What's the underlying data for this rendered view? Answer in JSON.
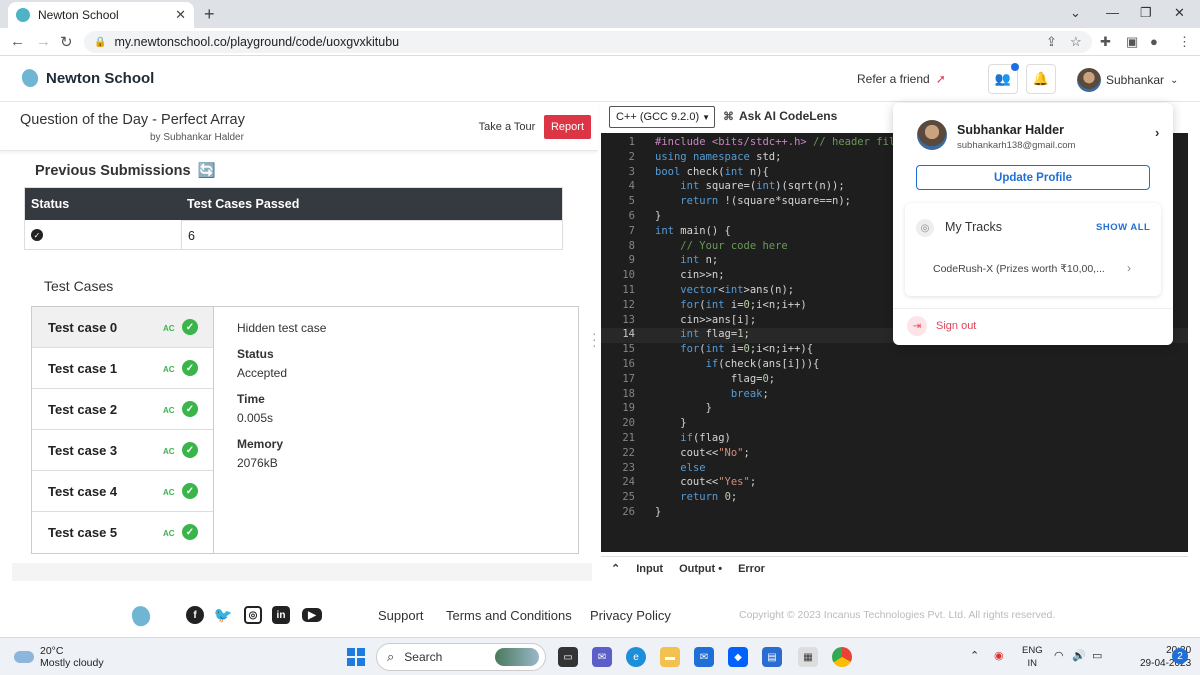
{
  "browser": {
    "tab_title": "Newton School",
    "url": "my.newtonschool.co/playground/code/uoxgvxkitubu"
  },
  "header": {
    "brand": "Newton School",
    "refer": "Refer a friend",
    "username": "Subhankar"
  },
  "question": {
    "title": "Question of the Day - Perfect Array",
    "author": "by Subhankar Halder",
    "tour_label": "Take a Tour",
    "report_label": "Report"
  },
  "previous_submissions": {
    "title": "Previous Submissions",
    "headers": [
      "Status",
      "Test Cases Passed"
    ],
    "rows": [
      {
        "status": "accepted",
        "passed": "6"
      }
    ]
  },
  "test_cases": {
    "title": "Test Cases",
    "items": [
      {
        "label": "Test case 0",
        "badge": "AC"
      },
      {
        "label": "Test case 1",
        "badge": "AC"
      },
      {
        "label": "Test case 2",
        "badge": "AC"
      },
      {
        "label": "Test case 3",
        "badge": "AC"
      },
      {
        "label": "Test case 4",
        "badge": "AC"
      },
      {
        "label": "Test case 5",
        "badge": "AC"
      }
    ],
    "detail": {
      "hidden": "Hidden test case",
      "status_label": "Status",
      "status_value": "Accepted",
      "time_label": "Time",
      "time_value": "0.005s",
      "memory_label": "Memory",
      "memory_value": "2076kB"
    }
  },
  "editor": {
    "language": "C++ (GCC 9.2.0)",
    "ask_ai": "Ask AI CodeLens",
    "current_line": 14,
    "lines": [
      "#include <bits/stdc++.h> // header file",
      "using namespace std;",
      "bool check(int n){",
      "    int square=(int)(sqrt(n));",
      "    return !(square*square==n);",
      "}",
      "int main() {",
      "    // Your code here",
      "    int n;",
      "    cin>>n;",
      "    vector<int>ans(n);",
      "    for(int i=0;i<n;i++)",
      "    cin>>ans[i];",
      "    int flag=1;",
      "    for(int i=0;i<n;i++){",
      "        if(check(ans[i])){",
      "            flag=0;",
      "            break;",
      "        }",
      "    }",
      "    if(flag)",
      "    cout<<\"No\";",
      "    else",
      "    cout<<\"Yes\";",
      "    return 0;",
      "}"
    ],
    "io_tabs": [
      "Input",
      "Output •",
      "Error"
    ]
  },
  "profile_menu": {
    "name": "Subhankar Halder",
    "email": "subhankarh138@gmail.com",
    "update_label": "Update Profile",
    "tracks_title": "My Tracks",
    "show_all": "SHOW ALL",
    "track_item": "CodeRush-X (Prizes worth ₹10,00,...",
    "signout": "Sign out"
  },
  "footer": {
    "links": [
      "Support",
      "Terms and Conditions",
      "Privacy Policy"
    ],
    "copyright": "Copyright © 2023 Incanus Technologies Pvt. Ltd. All rights reserved.",
    "social_icons": [
      "facebook-icon",
      "twitter-icon",
      "instagram-icon",
      "linkedin-icon",
      "youtube-icon"
    ]
  },
  "taskbar": {
    "temp": "20°C",
    "weather": "Mostly cloudy",
    "search": "Search",
    "lang_top": "ENG",
    "lang_bottom": "IN",
    "time": "20:30",
    "date": "29-04-2023",
    "notifications": "2"
  },
  "colors": {
    "report": "#dc3545",
    "ac_green": "#3ab54a",
    "accent_blue": "#1f6fd6",
    "editor_bg": "#1e1e1e"
  }
}
